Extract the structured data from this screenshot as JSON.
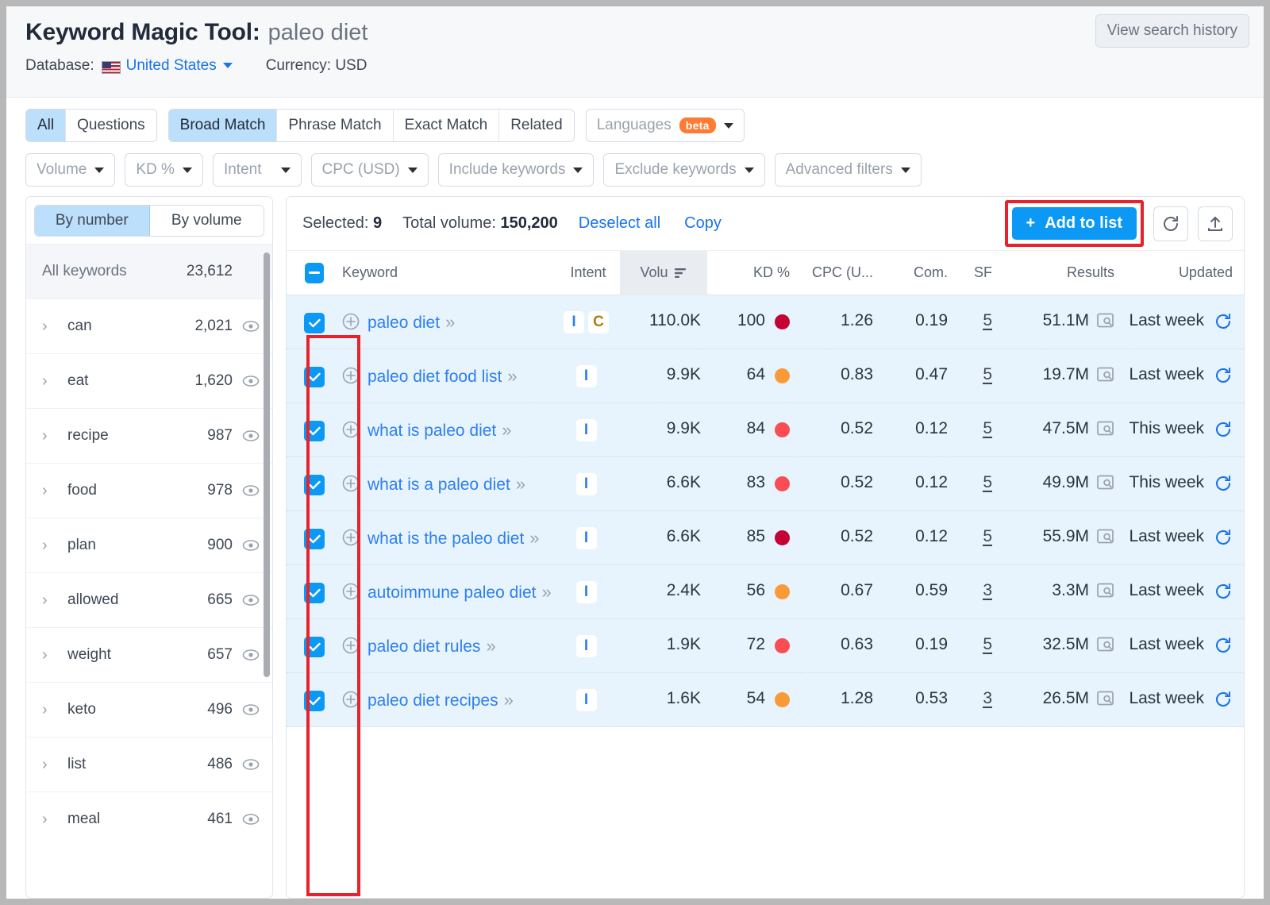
{
  "header": {
    "title_main": "Keyword Magic Tool:",
    "title_query": "paleo diet",
    "database_label": "Database:",
    "database_value": "United States",
    "currency": "Currency: USD",
    "view_history": "View search history",
    "flag_icon": "us-flag-icon"
  },
  "filters": {
    "match_group_1": [
      {
        "label": "All",
        "active": true
      },
      {
        "label": "Questions",
        "active": false
      }
    ],
    "match_group_2": [
      {
        "label": "Broad Match",
        "active": true
      },
      {
        "label": "Phrase Match",
        "active": false
      },
      {
        "label": "Exact Match",
        "active": false
      },
      {
        "label": "Related",
        "active": false
      }
    ],
    "languages": {
      "label": "Languages",
      "badge": "beta"
    },
    "dropdowns": [
      "Volume",
      "KD %",
      "Intent",
      "CPC (USD)",
      "Include keywords",
      "Exclude keywords",
      "Advanced filters"
    ]
  },
  "sidebar": {
    "toggle": [
      {
        "label": "By number",
        "active": true
      },
      {
        "label": "By volume",
        "active": false
      }
    ],
    "all_keywords": {
      "label": "All keywords",
      "count": "23,612"
    },
    "items": [
      {
        "label": "can",
        "count": "2,021"
      },
      {
        "label": "eat",
        "count": "1,620"
      },
      {
        "label": "recipe",
        "count": "987"
      },
      {
        "label": "food",
        "count": "978"
      },
      {
        "label": "plan",
        "count": "900"
      },
      {
        "label": "allowed",
        "count": "665"
      },
      {
        "label": "weight",
        "count": "657"
      },
      {
        "label": "keto",
        "count": "496"
      },
      {
        "label": "list",
        "count": "486"
      },
      {
        "label": "meal",
        "count": "461"
      }
    ]
  },
  "toolbar": {
    "selected_label": "Selected:",
    "selected_count": "9",
    "total_volume_label": "Total volume:",
    "total_volume": "150,200",
    "deselect_all": "Deselect all",
    "copy": "Copy",
    "add_to_list": "Add to list",
    "add_plus": "+",
    "refresh_icon": "refresh-icon",
    "export_icon": "export-icon",
    "highlight_color": "#e8212a",
    "accent_color": "#0c99f5"
  },
  "table": {
    "columns": [
      "Keyword",
      "Intent",
      "Volu",
      "KD %",
      "CPC (U...",
      "Com.",
      "SF",
      "Results",
      "Updated"
    ],
    "sorted_column": "Volu",
    "rows": [
      {
        "checked": true,
        "keyword": "paleo diet",
        "intents": [
          "I",
          "C"
        ],
        "volume": "110.0K",
        "kd": "100",
        "kd_color": "#c40233",
        "cpc": "1.26",
        "com": "0.19",
        "sf": "5",
        "results": "51.1M",
        "updated": "Last week"
      },
      {
        "checked": true,
        "keyword": "paleo diet food list",
        "intents": [
          "I"
        ],
        "volume": "9.9K",
        "kd": "64",
        "kd_color": "#f89a38",
        "cpc": "0.83",
        "com": "0.47",
        "sf": "5",
        "results": "19.7M",
        "updated": "Last week"
      },
      {
        "checked": true,
        "keyword": "what is paleo diet",
        "intents": [
          "I"
        ],
        "volume": "9.9K",
        "kd": "84",
        "kd_color": "#fb4b53",
        "cpc": "0.52",
        "com": "0.12",
        "sf": "5",
        "results": "47.5M",
        "updated": "This week"
      },
      {
        "checked": true,
        "keyword": "what is a paleo diet",
        "intents": [
          "I"
        ],
        "volume": "6.6K",
        "kd": "83",
        "kd_color": "#fb4b53",
        "cpc": "0.52",
        "com": "0.12",
        "sf": "5",
        "results": "49.9M",
        "updated": "This week"
      },
      {
        "checked": true,
        "keyword": "what is the paleo diet",
        "intents": [
          "I"
        ],
        "volume": "6.6K",
        "kd": "85",
        "kd_color": "#c40233",
        "cpc": "0.52",
        "com": "0.12",
        "sf": "5",
        "results": "55.9M",
        "updated": "Last week"
      },
      {
        "checked": true,
        "keyword": "autoimmune paleo diet",
        "intents": [
          "I"
        ],
        "volume": "2.4K",
        "kd": "56",
        "kd_color": "#f89a38",
        "cpc": "0.67",
        "com": "0.59",
        "sf": "3",
        "results": "3.3M",
        "updated": "Last week"
      },
      {
        "checked": true,
        "keyword": "paleo diet rules",
        "intents": [
          "I"
        ],
        "volume": "1.9K",
        "kd": "72",
        "kd_color": "#fb4b53",
        "cpc": "0.63",
        "com": "0.19",
        "sf": "5",
        "results": "32.5M",
        "updated": "Last week"
      },
      {
        "checked": true,
        "keyword": "paleo diet recipes",
        "intents": [
          "I"
        ],
        "volume": "1.6K",
        "kd": "54",
        "kd_color": "#f89a38",
        "cpc": "1.28",
        "com": "0.53",
        "sf": "3",
        "results": "26.5M",
        "updated": "Last week"
      }
    ]
  }
}
